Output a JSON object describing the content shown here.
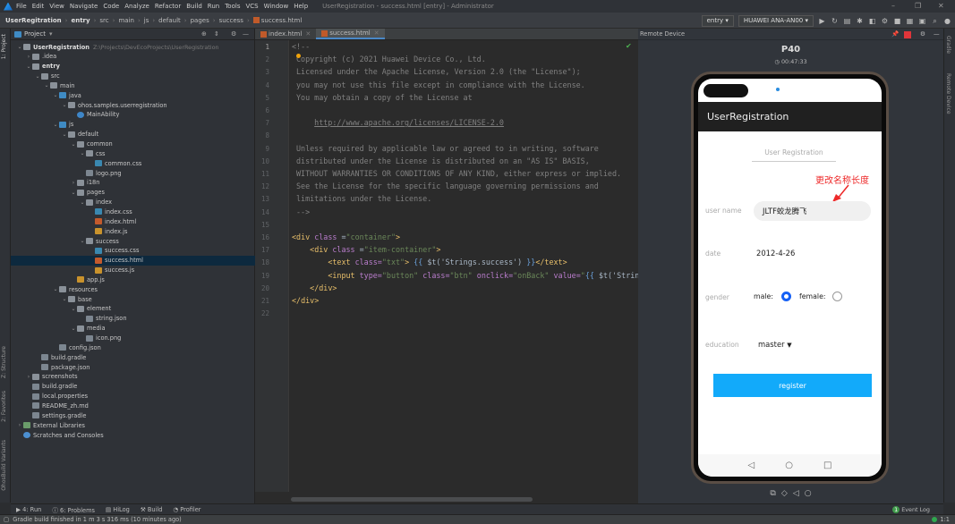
{
  "menubar": {
    "items": [
      "File",
      "Edit",
      "View",
      "Navigate",
      "Code",
      "Analyze",
      "Refactor",
      "Build",
      "Run",
      "Tools",
      "VCS",
      "Window",
      "Help"
    ],
    "window_title": "UserRegistration - success.html [entry] - Administrator"
  },
  "breadcrumb": [
    "UserRegitration",
    "entry",
    "src",
    "main",
    "js",
    "default",
    "pages",
    "success",
    "success.html"
  ],
  "toolbar": {
    "run_config": "entry",
    "device": "HUAWEI ANA-AN00"
  },
  "left_stripe": [
    "1: Project",
    "Z: Structure",
    "2: Favorites",
    "OhosBuild Variants"
  ],
  "right_stripe": [
    "Gradle",
    "Remote Device"
  ],
  "project": {
    "header": "Project",
    "tree": [
      {
        "label": "UserRegistration",
        "path": "Z:\\Projects\\DevEcoProjects\\UserRegistration",
        "level": 0,
        "expanded": true,
        "icon": "module",
        "bold": true
      },
      {
        "label": ".idea",
        "level": 1,
        "expanded": false,
        "icon": "folder"
      },
      {
        "label": "entry",
        "level": 1,
        "expanded": true,
        "icon": "module",
        "bold": true
      },
      {
        "label": "src",
        "level": 2,
        "expanded": true,
        "icon": "folder"
      },
      {
        "label": "main",
        "level": 3,
        "expanded": true,
        "icon": "folder"
      },
      {
        "label": "java",
        "level": 4,
        "expanded": true,
        "icon": "srcfolder"
      },
      {
        "label": "ohos.samples.userregistration",
        "level": 5,
        "expanded": true,
        "icon": "folder"
      },
      {
        "label": "MainAbility",
        "level": 6,
        "icon": "class"
      },
      {
        "label": "js",
        "level": 4,
        "expanded": true,
        "icon": "srcfolder"
      },
      {
        "label": "default",
        "level": 5,
        "expanded": true,
        "icon": "folder"
      },
      {
        "label": "common",
        "level": 6,
        "expanded": true,
        "icon": "folder"
      },
      {
        "label": "css",
        "level": 7,
        "expanded": true,
        "icon": "folder"
      },
      {
        "label": "common.css",
        "level": 8,
        "icon": "css"
      },
      {
        "label": "logo.png",
        "level": 7,
        "icon": "img"
      },
      {
        "label": "i18n",
        "level": 6,
        "expanded": false,
        "icon": "folder"
      },
      {
        "label": "pages",
        "level": 6,
        "expanded": true,
        "icon": "folder"
      },
      {
        "label": "index",
        "level": 7,
        "expanded": true,
        "icon": "folder"
      },
      {
        "label": "index.css",
        "level": 8,
        "icon": "css"
      },
      {
        "label": "index.html",
        "level": 8,
        "icon": "html"
      },
      {
        "label": "index.js",
        "level": 8,
        "icon": "js"
      },
      {
        "label": "success",
        "level": 7,
        "expanded": true,
        "icon": "folder"
      },
      {
        "label": "success.css",
        "level": 8,
        "icon": "css"
      },
      {
        "label": "success.html",
        "level": 8,
        "icon": "html",
        "selected": true
      },
      {
        "label": "success.js",
        "level": 8,
        "icon": "js"
      },
      {
        "label": "app.js",
        "level": 6,
        "icon": "js"
      },
      {
        "label": "resources",
        "level": 4,
        "expanded": true,
        "icon": "folder"
      },
      {
        "label": "base",
        "level": 5,
        "expanded": true,
        "icon": "folder"
      },
      {
        "label": "element",
        "level": 6,
        "expanded": true,
        "icon": "folder"
      },
      {
        "label": "string.json",
        "level": 7,
        "icon": "json"
      },
      {
        "label": "media",
        "level": 6,
        "expanded": true,
        "icon": "folder"
      },
      {
        "label": "icon.png",
        "level": 7,
        "icon": "img"
      },
      {
        "label": "config.json",
        "level": 4,
        "icon": "json"
      },
      {
        "label": "build.gradle",
        "level": 2,
        "icon": "gradle"
      },
      {
        "label": "package.json",
        "level": 2,
        "icon": "json"
      },
      {
        "label": "screenshots",
        "level": 1,
        "expanded": false,
        "icon": "folder"
      },
      {
        "label": "build.gradle",
        "level": 1,
        "icon": "gradle"
      },
      {
        "label": "local.properties",
        "level": 1,
        "icon": "prop"
      },
      {
        "label": "README_zh.md",
        "level": 1,
        "icon": "md"
      },
      {
        "label": "settings.gradle",
        "level": 1,
        "icon": "gradle"
      },
      {
        "label": "External Libraries",
        "level": 0,
        "expanded": false,
        "icon": "lib"
      },
      {
        "label": "Scratches and Consoles",
        "level": 0,
        "icon": "scratch"
      }
    ]
  },
  "editor": {
    "tabs": [
      {
        "label": "index.html",
        "active": false
      },
      {
        "label": "success.html",
        "active": true
      }
    ],
    "current_line": 1,
    "lines": [
      [
        [
          "<!--",
          "com"
        ]
      ],
      [
        [
          "Copyright (c) 2021 Huawei Device Co., Ltd.",
          "com"
        ]
      ],
      [
        [
          "Licensed under the Apache License, Version 2.0 (the \"License\");",
          "com"
        ]
      ],
      [
        [
          "you may not use this file except in compliance with the License.",
          "com"
        ]
      ],
      [
        [
          "You may obtain a copy of the License at",
          "com"
        ]
      ],
      [],
      [
        [
          "    ",
          "com"
        ],
        [
          "http://www.apache.org/licenses/LICENSE-2.0",
          "link"
        ]
      ],
      [],
      [
        [
          "Unless required by applicable law or agreed to in writing, software",
          "com"
        ]
      ],
      [
        [
          "distributed under the License is distributed on an \"AS IS\" BASIS,",
          "com"
        ]
      ],
      [
        [
          "WITHOUT WARRANTIES OR CONDITIONS OF ANY KIND, either express or implied.",
          "com"
        ]
      ],
      [
        [
          "See the License for the specific language governing permissions and",
          "com"
        ]
      ],
      [
        [
          "limitations under the License.",
          "com"
        ]
      ],
      [
        [
          "-->",
          "com"
        ]
      ],
      [],
      [
        [
          "<div ",
          "tag"
        ],
        [
          "class ",
          "attr"
        ],
        [
          "=",
          "plain"
        ],
        [
          "\"container\"",
          "str"
        ],
        [
          ">",
          "tag"
        ]
      ],
      [
        [
          "    <div ",
          "tag"
        ],
        [
          "class ",
          "attr"
        ],
        [
          "=",
          "plain"
        ],
        [
          "\"item-container\"",
          "str"
        ],
        [
          ">",
          "tag"
        ]
      ],
      [
        [
          "        <text ",
          "tag"
        ],
        [
          "class=",
          "attr"
        ],
        [
          "\"txt\"",
          "str"
        ],
        [
          "> ",
          "tag"
        ],
        [
          "{{ ",
          "br"
        ],
        [
          "$t('Strings.success') ",
          "plain"
        ],
        [
          "}}",
          "br"
        ],
        [
          "</text>",
          "tag"
        ]
      ],
      [
        [
          "        <input ",
          "tag"
        ],
        [
          "type=",
          "attr"
        ],
        [
          "\"button\" ",
          "str"
        ],
        [
          "class=",
          "attr"
        ],
        [
          "\"btn\" ",
          "str"
        ],
        [
          "onclick=",
          "attr"
        ],
        [
          "\"onBack\" ",
          "str"
        ],
        [
          "value=",
          "attr"
        ],
        [
          "\"",
          "str"
        ],
        [
          "{{ ",
          "br"
        ],
        [
          "$t('Strings.back') }}\"",
          "plain"
        ]
      ],
      [
        [
          "    </div>",
          "tag"
        ]
      ],
      [
        [
          "</div>",
          "tag"
        ]
      ],
      []
    ]
  },
  "remote_device": {
    "title": "Remote Device",
    "device_name": "P40",
    "timer": "00:47:33",
    "app": {
      "app_title": "UserRegistration",
      "form_title": "User Registration",
      "annotation": "更改名称长度",
      "username_label": "user name",
      "username_value": "JLTF蛟龙腾飞",
      "date_label": "date",
      "date_value": "2012-4-26",
      "gender_label": "gender",
      "male_label": "male:",
      "female_label": "female:",
      "gender_selected": "male",
      "education_label": "education",
      "education_value": "master",
      "register_label": "register",
      "accent": "#12aafa",
      "annotation_color": "#ee2a2a"
    }
  },
  "bottom_tools": [
    "4: Run",
    "6: Problems",
    "HiLog",
    "Build",
    "Profiler"
  ],
  "event_log": {
    "label": "Event Log",
    "count": "1"
  },
  "status": {
    "message": "Gradle build finished in 1 m 3 s 316 ms (10 minutes ago)",
    "position": "1:1"
  }
}
